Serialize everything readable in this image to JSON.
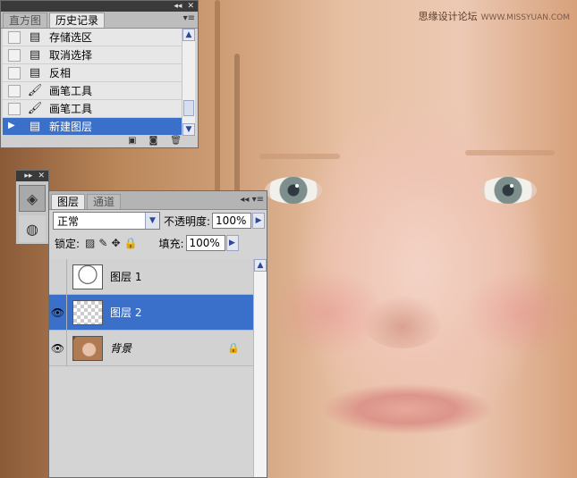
{
  "watermark": {
    "text": "思缘设计论坛",
    "url": "WWW.MISSYUAN.COM"
  },
  "history_panel": {
    "title_controls": [
      "◂◂",
      "✕"
    ],
    "tabs": [
      {
        "label": "直方图",
        "active": false
      },
      {
        "label": "历史记录",
        "active": true
      }
    ],
    "menu_icon": "panel-menu-icon",
    "items": [
      {
        "label": "存储选区",
        "icon": "doc-icon",
        "selected": false
      },
      {
        "label": "取消选择",
        "icon": "doc-icon",
        "selected": false
      },
      {
        "label": "反相",
        "icon": "doc-icon",
        "selected": false
      },
      {
        "label": "画笔工具",
        "icon": "brush-icon",
        "selected": false
      },
      {
        "label": "画笔工具",
        "icon": "brush-icon",
        "selected": false
      },
      {
        "label": "新建图层",
        "icon": "doc-icon",
        "selected": true
      }
    ],
    "footer_icons": [
      "new-document-icon",
      "snapshot-icon",
      "trash-icon"
    ]
  },
  "layers_panel": {
    "title_controls": [
      "▸▸",
      "✕"
    ],
    "tabs": [
      {
        "label": "图层",
        "active": true
      },
      {
        "label": "通道",
        "active": false
      }
    ],
    "blend_mode": "正常",
    "opacity_label": "不透明度:",
    "opacity_value": "100%",
    "lock_label": "锁定:",
    "fill_label": "填充:",
    "fill_value": "100%",
    "layers": [
      {
        "name": "图层 1",
        "visible": false,
        "selected": false,
        "thumb": "sketch",
        "locked": false
      },
      {
        "name": "图层 2",
        "visible": true,
        "selected": true,
        "thumb": "transparent",
        "locked": false
      },
      {
        "name": "背景",
        "visible": true,
        "selected": false,
        "thumb": "photo",
        "locked": true
      }
    ]
  },
  "colors": {
    "selection": "#3a70c9",
    "panel_bg": "#d4d4d4",
    "titlebar": "#3a3a3a"
  }
}
